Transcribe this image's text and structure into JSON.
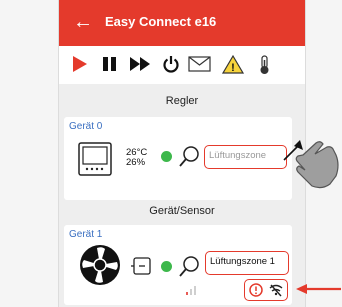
{
  "app": {
    "title": "Easy Connect e16",
    "back_icon": "arrow-left-icon"
  },
  "toolbar": {
    "icons": [
      "play-icon",
      "pause-icon",
      "fast-forward-icon",
      "power-icon",
      "mail-icon",
      "warning-icon",
      "thermometer-icon"
    ]
  },
  "sections": {
    "regler": "Regler",
    "sensor": "Gerät/Sensor"
  },
  "device0": {
    "label": "Gerät 0",
    "temperature": "26°C",
    "humidity": "26%",
    "zone_placeholder": "Lüftungszone"
  },
  "device1": {
    "label": "Gerät 1",
    "zone": "Lüftungszone 1"
  },
  "colors": {
    "accent": "#e43a2c",
    "status": "#3db84b",
    "link": "#3a6fc1"
  }
}
